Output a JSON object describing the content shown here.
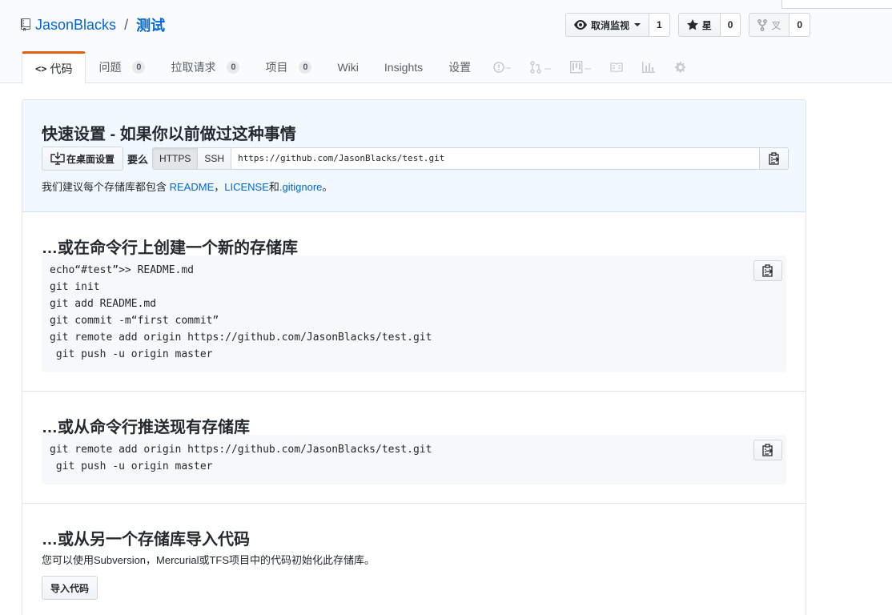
{
  "repo": {
    "owner": "JasonBlacks",
    "separator": "/",
    "name": "测试"
  },
  "actions": {
    "watch": {
      "label": "取消监视",
      "count": "1",
      "icon": "eye-icon"
    },
    "star": {
      "label": "星",
      "count": "0",
      "icon": "star-icon"
    },
    "fork": {
      "label": "叉",
      "count": "0",
      "icon": "fork-icon"
    }
  },
  "tabs": [
    {
      "label": "代码",
      "icon": "code-icon"
    },
    {
      "label": "问题",
      "count": "0"
    },
    {
      "label": "拉取请求",
      "count": "0"
    },
    {
      "label": "项目",
      "count": "0"
    },
    {
      "label": "Wiki"
    },
    {
      "label": "Insights"
    },
    {
      "label": "设置"
    }
  ],
  "tab_icons": [
    "issue-icon",
    "pull-request-icon",
    "project-icon",
    "wiki-icon",
    "graph-icon",
    "gear-icon"
  ],
  "quick_setup": {
    "title": "快速设置 - 如果你以前做过这种事情",
    "desktop_button": "在桌面设置",
    "or_label": "要么",
    "https_label": "HTTPS",
    "ssh_label": "SSH",
    "clone_url": "https://github.com/JasonBlacks/test.git",
    "recommend_prefix": "我们建议每个存储库都包含 ",
    "readme_link": "README",
    "comma": "，",
    "license_link": "LICENSE",
    "and_text": "和",
    "gitignore_link": ".gitignore",
    "period": "。"
  },
  "new_repo": {
    "title": "…或在命令行上创建一个新的存储库",
    "code": "echo“#test”>> README.md\ngit init\ngit add README.md\ngit commit -m“first commit”\ngit remote add origin https://github.com/JasonBlacks/test.git\n git push -u origin master"
  },
  "push_repo": {
    "title": "…或从命令行推送现有存储库",
    "code": "git remote add origin https://github.com/JasonBlacks/test.git\n git push -u origin master"
  },
  "import_repo": {
    "title": "…或从另一个存储库导入代码",
    "description": "您可以使用Subversion，Mercurial或TFS项目中的代码初始化此存储库。",
    "button": "导入代码"
  },
  "colors": {
    "link": "#0366d6",
    "tab_accent": "#e36209",
    "quick_bg": "#f1f8ff"
  }
}
